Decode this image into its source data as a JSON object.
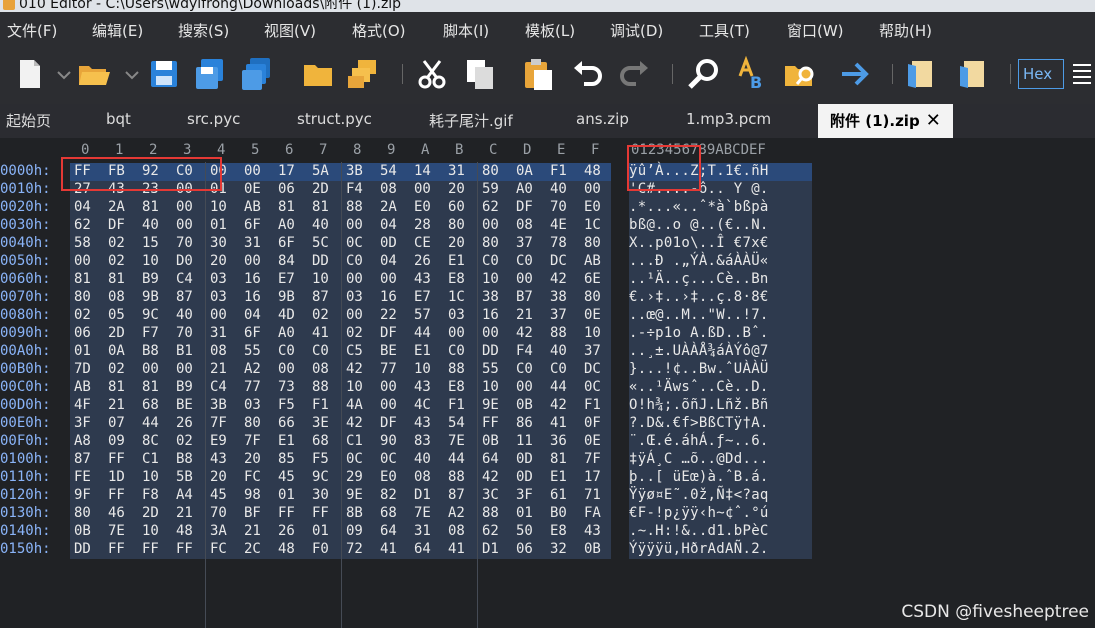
{
  "window": {
    "title": "010 Editor - C:\\Users\\wdyifrong\\Downloads\\附件 (1).zip"
  },
  "menu": [
    "文件(F)",
    "编辑(E)",
    "搜索(S)",
    "视图(V)",
    "格式(O)",
    "脚本(I)",
    "模板(L)",
    "调试(D)",
    "工具(T)",
    "窗口(W)",
    "帮助(H)"
  ],
  "toolbar": {
    "icons": [
      "new-file-icon",
      "open-folder-icon",
      "save-icon",
      "save-as-icon",
      "save-all-icon",
      "folder-icon",
      "copy-files-icon",
      "cut-icon",
      "copy-icon",
      "paste-icon",
      "undo-icon",
      "redo-icon",
      "find-icon",
      "replace-icon",
      "find-in-files-icon",
      "goto-icon",
      "script-icon",
      "template-icon",
      "hex-mode-icon"
    ],
    "hex_label": "Hex"
  },
  "tabs": [
    "起始页",
    "bqt",
    "src.pyc",
    "struct.pyc",
    "耗子尾汁.gif",
    "ans.zip",
    "1.mp3.pcm",
    "附件 (1).zip"
  ],
  "active_tab_close": "✕",
  "columns": [
    "0",
    "1",
    "2",
    "3",
    "4",
    "5",
    "6",
    "7",
    "8",
    "9",
    "A",
    "B",
    "C",
    "D",
    "E",
    "F"
  ],
  "ascii_header": "0123456789ABCDEF",
  "rows": [
    {
      "addr": "0000h:",
      "hex": "FF FB 92 C0 00 00 17 5A 3B 54 14 31 80 0A F1 48",
      "ascii": "ÿû’À...Z;T.1€.ñH"
    },
    {
      "addr": "0010h:",
      "hex": "27 43 23 00 01 0E 06 2D F4 08 00 20 59 A0 40 00",
      "ascii": "'C#....-ô.. Y @."
    },
    {
      "addr": "0020h:",
      "hex": "04 2A 81 00 10 AB 81 81 88 2A E0 60 62 DF 70 E0",
      "ascii": ".*...«..ˆ*à`bßpà"
    },
    {
      "addr": "0030h:",
      "hex": "62 DF 40 00 01 6F A0 40 00 04 28 80 00 08 4E 1C",
      "ascii": "bß@..o @..(€..N."
    },
    {
      "addr": "0040h:",
      "hex": "58 02 15 70 30 31 6F 5C 0C 0D CE 20 80 37 78 80",
      "ascii": "X..p01o\\..Î €7x€"
    },
    {
      "addr": "0050h:",
      "hex": "00 02 10 D0 20 00 84 DD C0 04 26 E1 C0 C0 DC AB",
      "ascii": "...Ð .„ÝÀ.&áÀÀÜ«"
    },
    {
      "addr": "0060h:",
      "hex": "81 81 B9 C4 03 16 E7 10 00 00 43 E8 10 00 42 6E",
      "ascii": "..¹Ä..ç...Cè..Bn"
    },
    {
      "addr": "0070h:",
      "hex": "80 08 9B 87 03 16 9B 87 03 16 E7 1C 38 B7 38 80",
      "ascii": "€.›‡..›‡..ç.8·8€"
    },
    {
      "addr": "0080h:",
      "hex": "02 05 9C 40 00 04 4D 02 00 22 57 03 16 21 37 0E",
      "ascii": "..œ@..M..\"W..!7."
    },
    {
      "addr": "0090h:",
      "hex": "06 2D F7 70 31 6F A0 41 02 DF 44 00 00 42 88 10",
      "ascii": ".-÷p1o A.ßD..Bˆ."
    },
    {
      "addr": "00A0h:",
      "hex": "01 0A B8 B1 08 55 C0 C0 C5 BE E1 C0 DD F4 40 37",
      "ascii": "..¸±.UÀÀÅ¾áÀÝô@7"
    },
    {
      "addr": "00B0h:",
      "hex": "7D 02 00 00 21 A2 00 08 42 77 10 88 55 C0 C0 DC",
      "ascii": "}...!¢..Bw.ˆUÀÀÜ"
    },
    {
      "addr": "00C0h:",
      "hex": "AB 81 81 B9 C4 77 73 88 10 00 43 E8 10 00 44 0C",
      "ascii": "«..¹Äwsˆ..Cè..D."
    },
    {
      "addr": "00D0h:",
      "hex": "4F 21 68 BE 3B 03 F5 F1 4A 00 4C F1 9E 0B 42 F1",
      "ascii": "O!h¾;.õñJ.Lñž.Bñ"
    },
    {
      "addr": "00E0h:",
      "hex": "3F 07 44 26 7F 80 66 3E 42 DF 43 54 FF 86 41 0F",
      "ascii": "?.D&.€f>BßCTÿ†A."
    },
    {
      "addr": "00F0h:",
      "hex": "A8 09 8C 02 E9 7F E1 68 C1 90 83 7E 0B 11 36 0E",
      "ascii": "¨.Œ.é.áhÁ.ƒ~..6."
    },
    {
      "addr": "0100h:",
      "hex": "87 FF C1 B8 43 20 85 F5 0C 0C 40 44 64 0D 81 7F",
      "ascii": "‡ÿÁ¸C …õ..@Dd..."
    },
    {
      "addr": "0110h:",
      "hex": "FE 1D 10 5B 20 FC 45 9C 29 E0 08 88 42 0D E1 17",
      "ascii": "þ..[ üEœ)à.ˆB.á."
    },
    {
      "addr": "0120h:",
      "hex": "9F FF F8 A4 45 98 01 30 9E 82 D1 87 3C 3F 61 71",
      "ascii": "Ÿÿø¤E˜.0ž‚Ñ‡<?aq"
    },
    {
      "addr": "0130h:",
      "hex": "80 46 2D 21 70 BF FF FF 8B 68 7E A2 88 01 B0 FA",
      "ascii": "€F-!p¿ÿÿ‹h~¢ˆ.°ú"
    },
    {
      "addr": "0140h:",
      "hex": "0B 7E 10 48 3A 21 26 01 09 64 31 08 62 50 E8 43",
      "ascii": ".~.H:!&..d1.bPèC"
    },
    {
      "addr": "0150h:",
      "hex": "DD FF FF FF FC 2C 48 F0 72 41 64 41 D1 06 32 0B",
      "ascii": "Ýÿÿÿü,HðrAdAÑ.2."
    }
  ],
  "watermark": "CSDN @fivesheeptree"
}
